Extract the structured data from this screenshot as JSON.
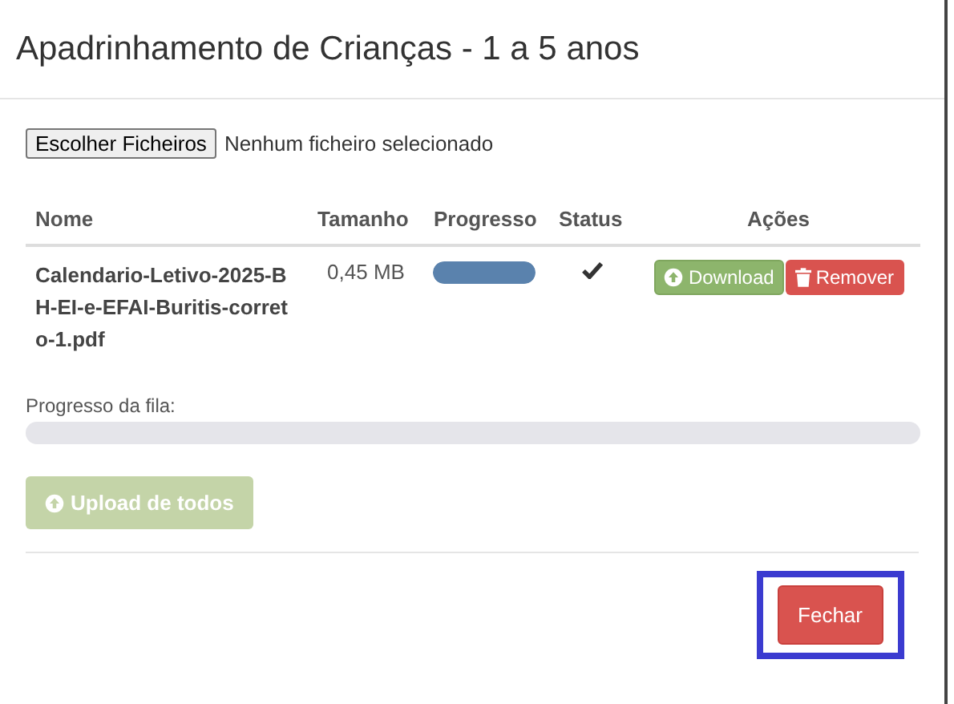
{
  "modal": {
    "title": "Apadrinhamento de Crianças - 1 a 5 anos"
  },
  "file_input": {
    "button": "Escolher Ficheiros",
    "status": "Nenhum ficheiro selecionado"
  },
  "table": {
    "columns": [
      "Nome",
      "Tamanho",
      "Progresso",
      "Status",
      "Ações"
    ],
    "rows": [
      {
        "name": "Calendario-Letivo-2025-BH-EI-e-EFAI-Buritis-correto-1.pdf",
        "size": "0,45 MB",
        "level": 1,
        "done": true,
        "actions": [
          {
            "label": "Download",
            "kind": "download"
          },
          {
            "label": "Remover",
            "kind": "remove"
          }
        ]
      }
    ]
  },
  "queue": {
    "label": "Progresso da fila:"
  },
  "upload_all": {
    "label": "Upload de todos",
    "disabled": true
  },
  "footer": {
    "close": {
      "label": "Fechar",
      "highlighted": true
    }
  }
}
